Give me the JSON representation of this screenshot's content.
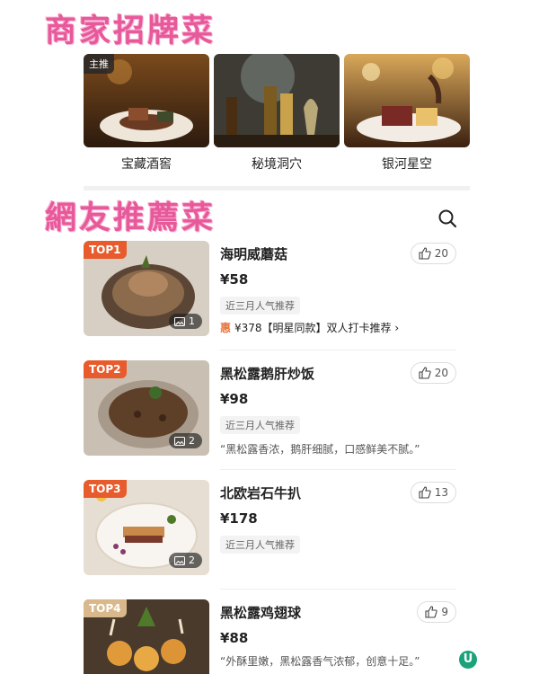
{
  "signature": {
    "title": "商家招牌菜",
    "badge": "主推",
    "dishes": [
      {
        "name": "宝藏酒窖"
      },
      {
        "name": "秘境洞穴"
      },
      {
        "name": "银河星空"
      }
    ]
  },
  "recommend": {
    "title": "網友推薦菜",
    "search_icon": "search-icon",
    "items": [
      {
        "rank": "TOP1",
        "name": "海明威蘑菇",
        "price": "¥58",
        "tag": "近三月人气推荐",
        "likes": "20",
        "image_count": "1",
        "promo_label": "惠",
        "promo_text": "¥378【明星同款】双人打卡推荐 ›"
      },
      {
        "rank": "TOP2",
        "name": "黑松露鹅肝炒饭",
        "price": "¥98",
        "tag": "近三月人气推荐",
        "likes": "20",
        "image_count": "2",
        "quote": "“黑松露香浓，鹅肝细腻，口感鲜美不腻。”"
      },
      {
        "rank": "TOP3",
        "name": "北欧岩石牛扒",
        "price": "¥178",
        "tag": "近三月人气推荐",
        "likes": "13",
        "image_count": "2"
      },
      {
        "rank": "TOP4",
        "name": "黑松露鸡翅球",
        "price": "¥88",
        "likes": "9",
        "quote": "“外酥里嫩，黑松露香气浓郁，创意十足。”"
      }
    ]
  },
  "colors": {
    "accent_title": "#e8599b",
    "top_badge": "#e85b2c",
    "top4_badge": "#d9b98b",
    "logo": "#1aa37a"
  },
  "floating_logo": "U"
}
